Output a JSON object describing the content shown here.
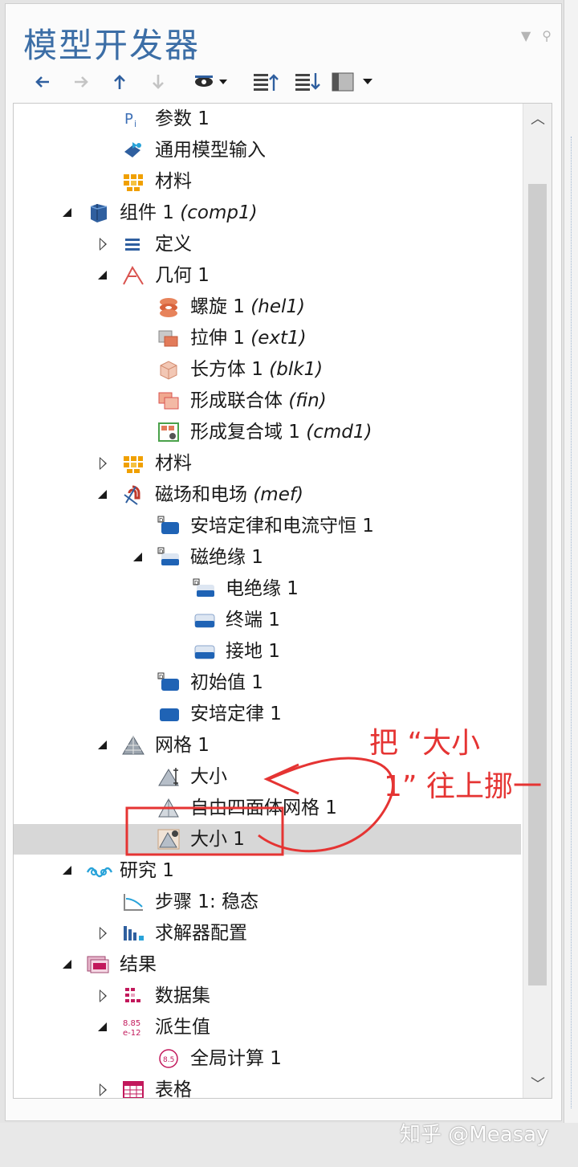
{
  "app": {
    "title": "模型开发器"
  },
  "colors": {
    "accent": "#3c6ea6",
    "annotation": "#e53433",
    "selection": "#d7d7d7"
  },
  "toolbar": {
    "buttons": [
      {
        "icon": "arrow-left-icon",
        "enabled": true
      },
      {
        "icon": "arrow-right-icon",
        "enabled": false
      },
      {
        "icon": "arrow-up-icon",
        "enabled": true
      },
      {
        "icon": "arrow-down-icon",
        "enabled": false
      },
      {
        "icon": "show-hide-icon",
        "enabled": true
      },
      {
        "icon": "expand-sections-icon",
        "enabled": true
      },
      {
        "icon": "collapse-sections-icon",
        "enabled": true
      },
      {
        "icon": "layout-icon",
        "enabled": true
      }
    ]
  },
  "tree": [
    {
      "label": "参数 1",
      "tag": "",
      "depth": 2,
      "toggle": "none",
      "icon": "parameters-icon"
    },
    {
      "label": "通用模型输入",
      "tag": "",
      "depth": 2,
      "toggle": "none",
      "icon": "model-input-icon"
    },
    {
      "label": "材料",
      "tag": "",
      "depth": 2,
      "toggle": "none",
      "icon": "materials-icon"
    },
    {
      "label": "组件 1",
      "tag": "(comp1)",
      "depth": 1,
      "toggle": "expanded",
      "icon": "component-icon"
    },
    {
      "label": "定义",
      "tag": "",
      "depth": 2,
      "toggle": "collapsed",
      "icon": "definitions-icon"
    },
    {
      "label": "几何 1",
      "tag": "",
      "depth": 2,
      "toggle": "expanded",
      "icon": "geometry-icon"
    },
    {
      "label": "螺旋 1",
      "tag": "(hel1)",
      "depth": 3,
      "toggle": "none",
      "icon": "helix-icon"
    },
    {
      "label": "拉伸 1",
      "tag": "(ext1)",
      "depth": 3,
      "toggle": "none",
      "icon": "extrude-icon"
    },
    {
      "label": "长方体 1",
      "tag": "(blk1)",
      "depth": 3,
      "toggle": "none",
      "icon": "block-icon"
    },
    {
      "label": "形成联合体",
      "tag": "(fin)",
      "depth": 3,
      "toggle": "none",
      "icon": "form-union-icon"
    },
    {
      "label": "形成复合域 1",
      "tag": "(cmd1)",
      "depth": 3,
      "toggle": "none",
      "icon": "composite-domain-icon"
    },
    {
      "label": "材料",
      "tag": "",
      "depth": 2,
      "toggle": "collapsed",
      "icon": "materials-icon"
    },
    {
      "label": "磁场和电场",
      "tag": "(mef)",
      "depth": 2,
      "toggle": "expanded",
      "icon": "magnetic-electric-fields-icon"
    },
    {
      "label": "安培定律和电流守恒 1",
      "tag": "",
      "depth": 3,
      "toggle": "none",
      "icon": "domain-feature-icon"
    },
    {
      "label": "磁绝缘 1",
      "tag": "",
      "depth": 3,
      "toggle": "expanded",
      "icon": "boundary-feature-icon"
    },
    {
      "label": "电绝缘 1",
      "tag": "",
      "depth": 4,
      "toggle": "none",
      "icon": "boundary-feature-icon"
    },
    {
      "label": "终端 1",
      "tag": "",
      "depth": 4,
      "toggle": "none",
      "icon": "boundary-plain-icon"
    },
    {
      "label": "接地 1",
      "tag": "",
      "depth": 4,
      "toggle": "none",
      "icon": "boundary-plain-icon"
    },
    {
      "label": "初始值 1",
      "tag": "",
      "depth": 3,
      "toggle": "none",
      "icon": "domain-feature-icon"
    },
    {
      "label": "安培定律 1",
      "tag": "",
      "depth": 3,
      "toggle": "none",
      "icon": "domain-plain-icon"
    },
    {
      "label": "网格 1",
      "tag": "",
      "depth": 2,
      "toggle": "expanded",
      "icon": "mesh-icon"
    },
    {
      "label": "大小",
      "tag": "",
      "depth": 3,
      "toggle": "none",
      "icon": "mesh-size-icon"
    },
    {
      "label": "自由四面体网格 1",
      "tag": "",
      "depth": 3,
      "toggle": "none",
      "icon": "free-tetrahedral-icon"
    },
    {
      "label": "大小 1",
      "tag": "",
      "depth": 3,
      "toggle": "none",
      "icon": "mesh-size-local-icon",
      "selected": true
    },
    {
      "label": "研究 1",
      "tag": "",
      "depth": 1,
      "toggle": "expanded",
      "icon": "study-icon"
    },
    {
      "label": "步骤 1: 稳态",
      "tag": "",
      "depth": 2,
      "toggle": "none",
      "icon": "stationary-step-icon"
    },
    {
      "label": "求解器配置",
      "tag": "",
      "depth": 2,
      "toggle": "collapsed",
      "icon": "solver-config-icon"
    },
    {
      "label": "结果",
      "tag": "",
      "depth": 1,
      "toggle": "expanded",
      "icon": "results-icon"
    },
    {
      "label": "数据集",
      "tag": "",
      "depth": 2,
      "toggle": "collapsed",
      "icon": "datasets-icon"
    },
    {
      "label": "派生值",
      "tag": "",
      "depth": 2,
      "toggle": "expanded",
      "icon": "derived-values-icon"
    },
    {
      "label": "全局计算 1",
      "tag": "",
      "depth": 3,
      "toggle": "none",
      "icon": "global-evaluation-icon"
    },
    {
      "label": "表格",
      "tag": "",
      "depth": 2,
      "toggle": "collapsed",
      "icon": "tables-icon"
    }
  ],
  "annotation": {
    "line1": "把 “大小",
    "line2": "1” 往上挪一"
  },
  "watermark": "知乎 @Measay"
}
